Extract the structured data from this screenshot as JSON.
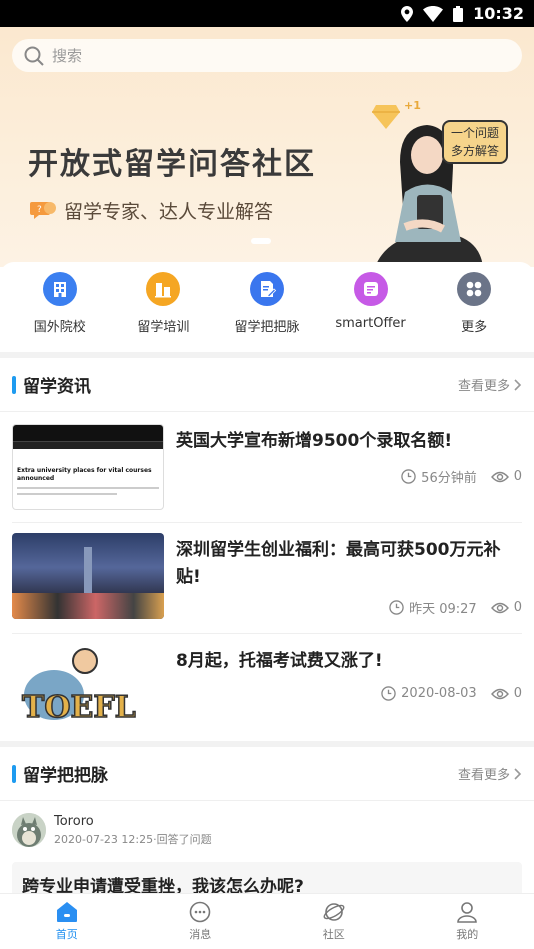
{
  "status": {
    "time": "10:32"
  },
  "search": {
    "placeholder": "搜索"
  },
  "banner": {
    "title": "开放式留学问答社区",
    "subtitle": "留学专家、达人专业解答",
    "note_line1": "一个问题",
    "note_line2": "多方解答"
  },
  "quicknav": [
    {
      "label": "国外院校",
      "icon": "building-icon",
      "color": "#3b7ff0"
    },
    {
      "label": "留学培训",
      "icon": "chart-bar-icon",
      "color": "#f5a623"
    },
    {
      "label": "留学把把脉",
      "icon": "doc-edit-icon",
      "color": "#3a76ee"
    },
    {
      "label": "smartOffer",
      "icon": "offer-icon",
      "color": "#c65ae6"
    },
    {
      "label": "更多",
      "icon": "grid-icon",
      "color": "#6b7488"
    }
  ],
  "news_section": {
    "title": "留学资讯",
    "more": "查看更多"
  },
  "news": [
    {
      "title": "英国大学宣布新增9500个录取名额!",
      "time": "56分钟前",
      "views": "0",
      "thumb_headline": "Extra university places for vital courses announced"
    },
    {
      "title": "深圳留学生创业福利：最高可获500万元补贴!",
      "time": "昨天 09:27",
      "views": "0"
    },
    {
      "title": "8月起，托福考试费又涨了!",
      "time": "2020-08-03",
      "views": "0",
      "thumb_text": "TOEFL"
    }
  ],
  "qa_section": {
    "title": "留学把把脉",
    "more": "查看更多"
  },
  "qa": {
    "user": "Tororo",
    "info": "2020-07-23 12:25·回答了问题",
    "question": "跨专业申请遭受重挫，我该怎么办呢?"
  },
  "tabs": [
    {
      "label": "首页",
      "active": true
    },
    {
      "label": "消息"
    },
    {
      "label": "社区"
    },
    {
      "label": "我的"
    }
  ],
  "colors": {
    "accent": "#1e9bf0",
    "banner_bg": "#fbe8cf"
  }
}
